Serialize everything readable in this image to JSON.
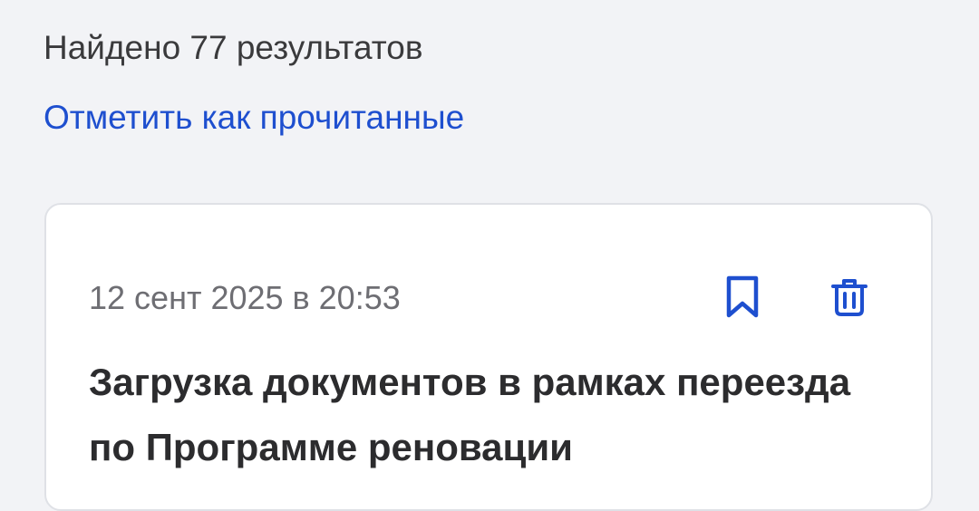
{
  "header": {
    "results_count": "Найдено 77 результатов",
    "mark_read_label": "Отметить как прочитанные"
  },
  "notification": {
    "date": "12 сент 2025 в 20:53",
    "title": "Загрузка документов в рамках переезда по Программе реновации"
  },
  "icons": {
    "bookmark": "bookmark-icon",
    "delete": "trash-icon"
  },
  "colors": {
    "background": "#f2f3f6",
    "accent": "#1e4fcf",
    "card": "#ffffff",
    "text_primary": "#2c2c2e",
    "text_secondary": "#6e6e73"
  }
}
